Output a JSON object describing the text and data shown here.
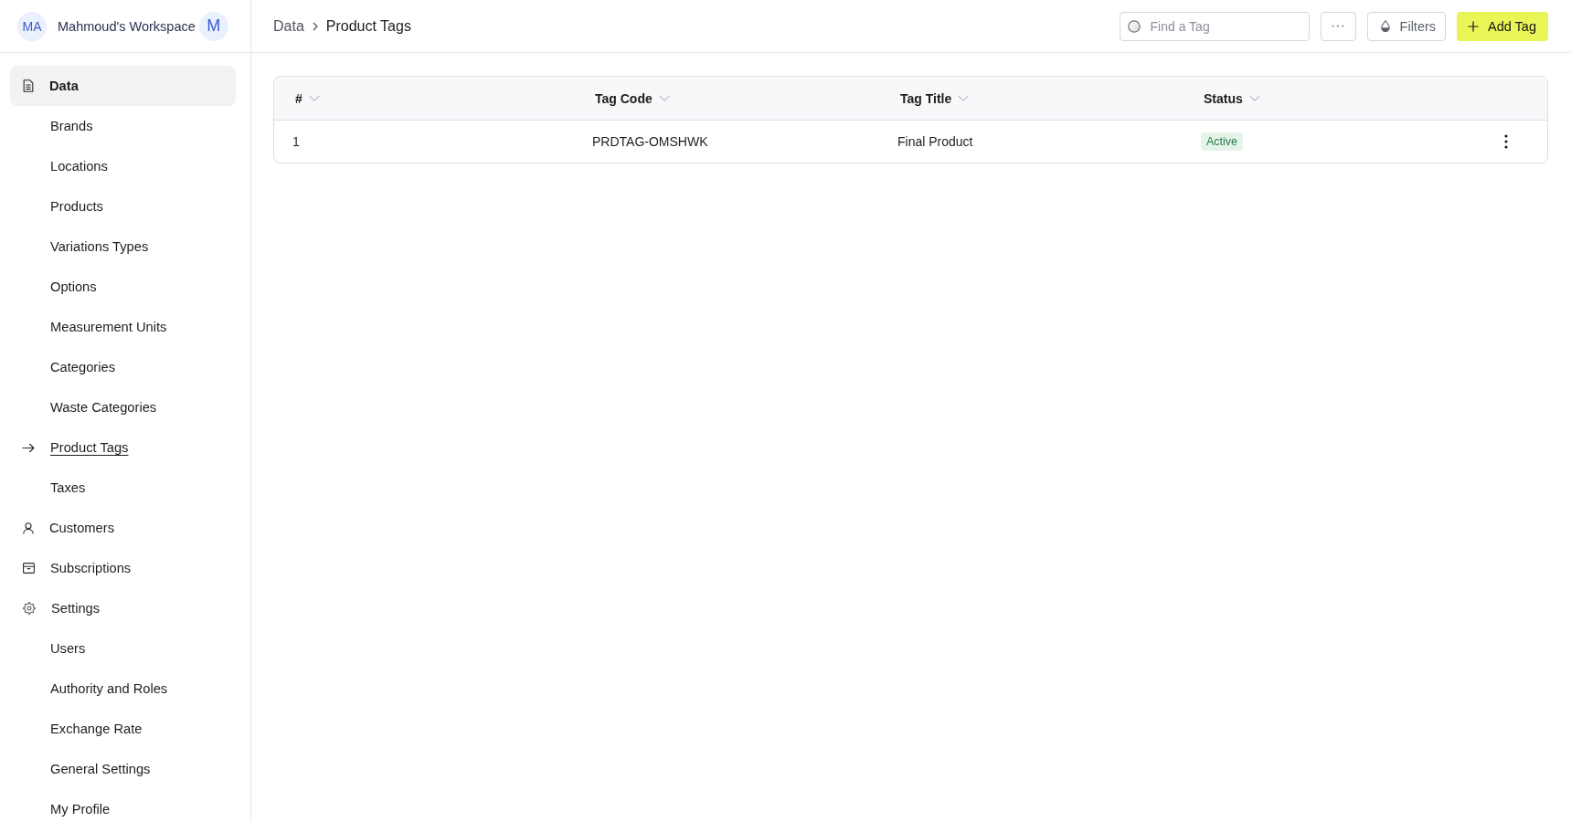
{
  "sidebar": {
    "workspace": {
      "avatar": "MA",
      "name": "Mahmoud's Workspace",
      "user_avatar": "M"
    },
    "items": [
      {
        "label": "Data",
        "selected": true,
        "children": [
          {
            "label": "Brands",
            "selected": false
          },
          {
            "label": "Locations",
            "selected": false
          },
          {
            "label": "Products",
            "selected": false
          },
          {
            "label": "Variations Types",
            "selected": false
          },
          {
            "label": "Options",
            "selected": false
          },
          {
            "label": "Measurement Units",
            "selected": false
          },
          {
            "label": "Categories",
            "selected": false
          },
          {
            "label": "Waste Categories",
            "selected": false
          },
          {
            "label": "Product Tags",
            "selected": true
          },
          {
            "label": "Taxes",
            "selected": false
          }
        ]
      },
      {
        "label": "Customers",
        "selected": false
      },
      {
        "label": "Subscriptions",
        "selected": false
      },
      {
        "label": "Settings",
        "selected": false,
        "children": [
          {
            "label": "Users",
            "selected": false
          },
          {
            "label": "Authority and Roles",
            "selected": false
          },
          {
            "label": "Exchange Rate",
            "selected": false
          },
          {
            "label": "General Settings",
            "selected": false
          },
          {
            "label": "My Profile",
            "selected": false
          }
        ]
      }
    ]
  },
  "header": {
    "breadcrumb": [
      "Data",
      "Product Tags"
    ],
    "search": {
      "placeholder": "Find a Tag"
    },
    "filter_button": {
      "label": "Filters"
    },
    "add_button": {
      "label": "Add Tag"
    }
  },
  "table": {
    "columns": [
      "#",
      "Tag Code",
      "Tag Title",
      "Status"
    ],
    "rows": [
      {
        "cells": [
          "1",
          "PRDTAG-OMSHWK",
          "Final Product"
        ],
        "status": "Active"
      }
    ]
  }
}
